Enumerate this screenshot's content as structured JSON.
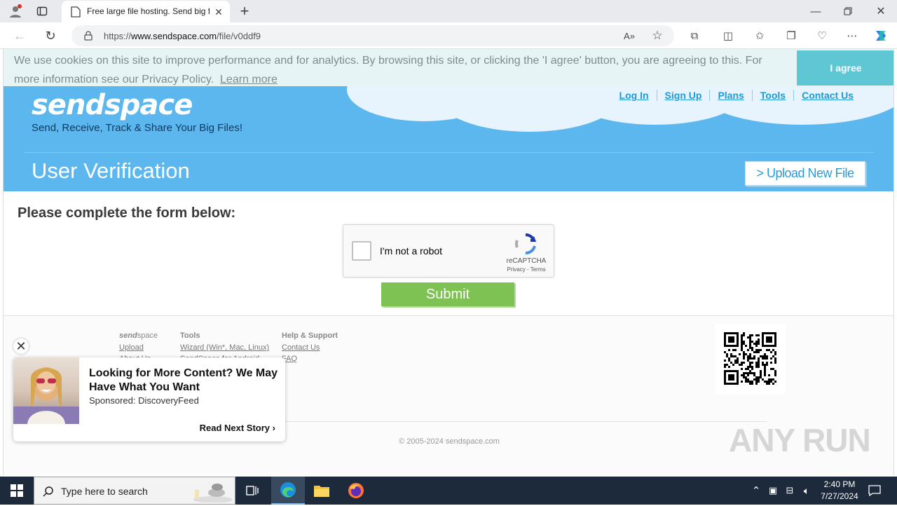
{
  "browser": {
    "tab_title": "Free large file hosting. Send big f",
    "url_prefix": "https://",
    "url_domain": "www.sendspace.com",
    "url_path": "/file/v0ddf9"
  },
  "cookie_banner": {
    "text": "We use cookies on this site to improve performance and for analytics. By browsing this site, or clicking the 'I agree' button, you are agreeing to this. For more information see our Privacy Policy.",
    "learn_more": "Learn more",
    "agree_label": "I agree"
  },
  "header": {
    "logo": "sendspace",
    "tagline": "Send, Receive, Track & Share Your Big Files!",
    "nav": [
      "Log In",
      "Sign Up",
      "Plans",
      "Tools",
      "Contact Us"
    ],
    "page_title": "User Verification",
    "upload_button": "> Upload New File"
  },
  "form": {
    "heading": "Please complete the form below:",
    "captcha_label": "I'm not a robot",
    "captcha_brand": "reCAPTCHA",
    "captcha_terms": "Privacy - Terms",
    "submit_label": "Submit"
  },
  "footer": {
    "col1": {
      "heading_a": "send",
      "heading_b": "space",
      "links": [
        "Upload",
        "About Us"
      ]
    },
    "col2": {
      "heading": "Tools",
      "links": [
        "Wizard (Win*, Mac, Linux)",
        "SendSpace for Android"
      ]
    },
    "col3": {
      "heading": "Help & Support",
      "links": [
        "Contact Us",
        "FAQ"
      ]
    },
    "copyright": "© 2005-2024 sendspace.com",
    "watermark": "ANY RUN"
  },
  "ad": {
    "title": "Looking for More Content? We May Have What You Want",
    "sponsor": "Sponsored: DiscoveryFeed",
    "cta": "Read Next Story"
  },
  "taskbar": {
    "search_placeholder": "Type here to search",
    "time": "2:40 PM",
    "date": "7/27/2024"
  },
  "colors": {
    "header_blue": "#5bb7ee",
    "accent_teal": "#5fc6d4",
    "submit_green": "#7dc252",
    "link_blue": "#1e9ad6"
  }
}
